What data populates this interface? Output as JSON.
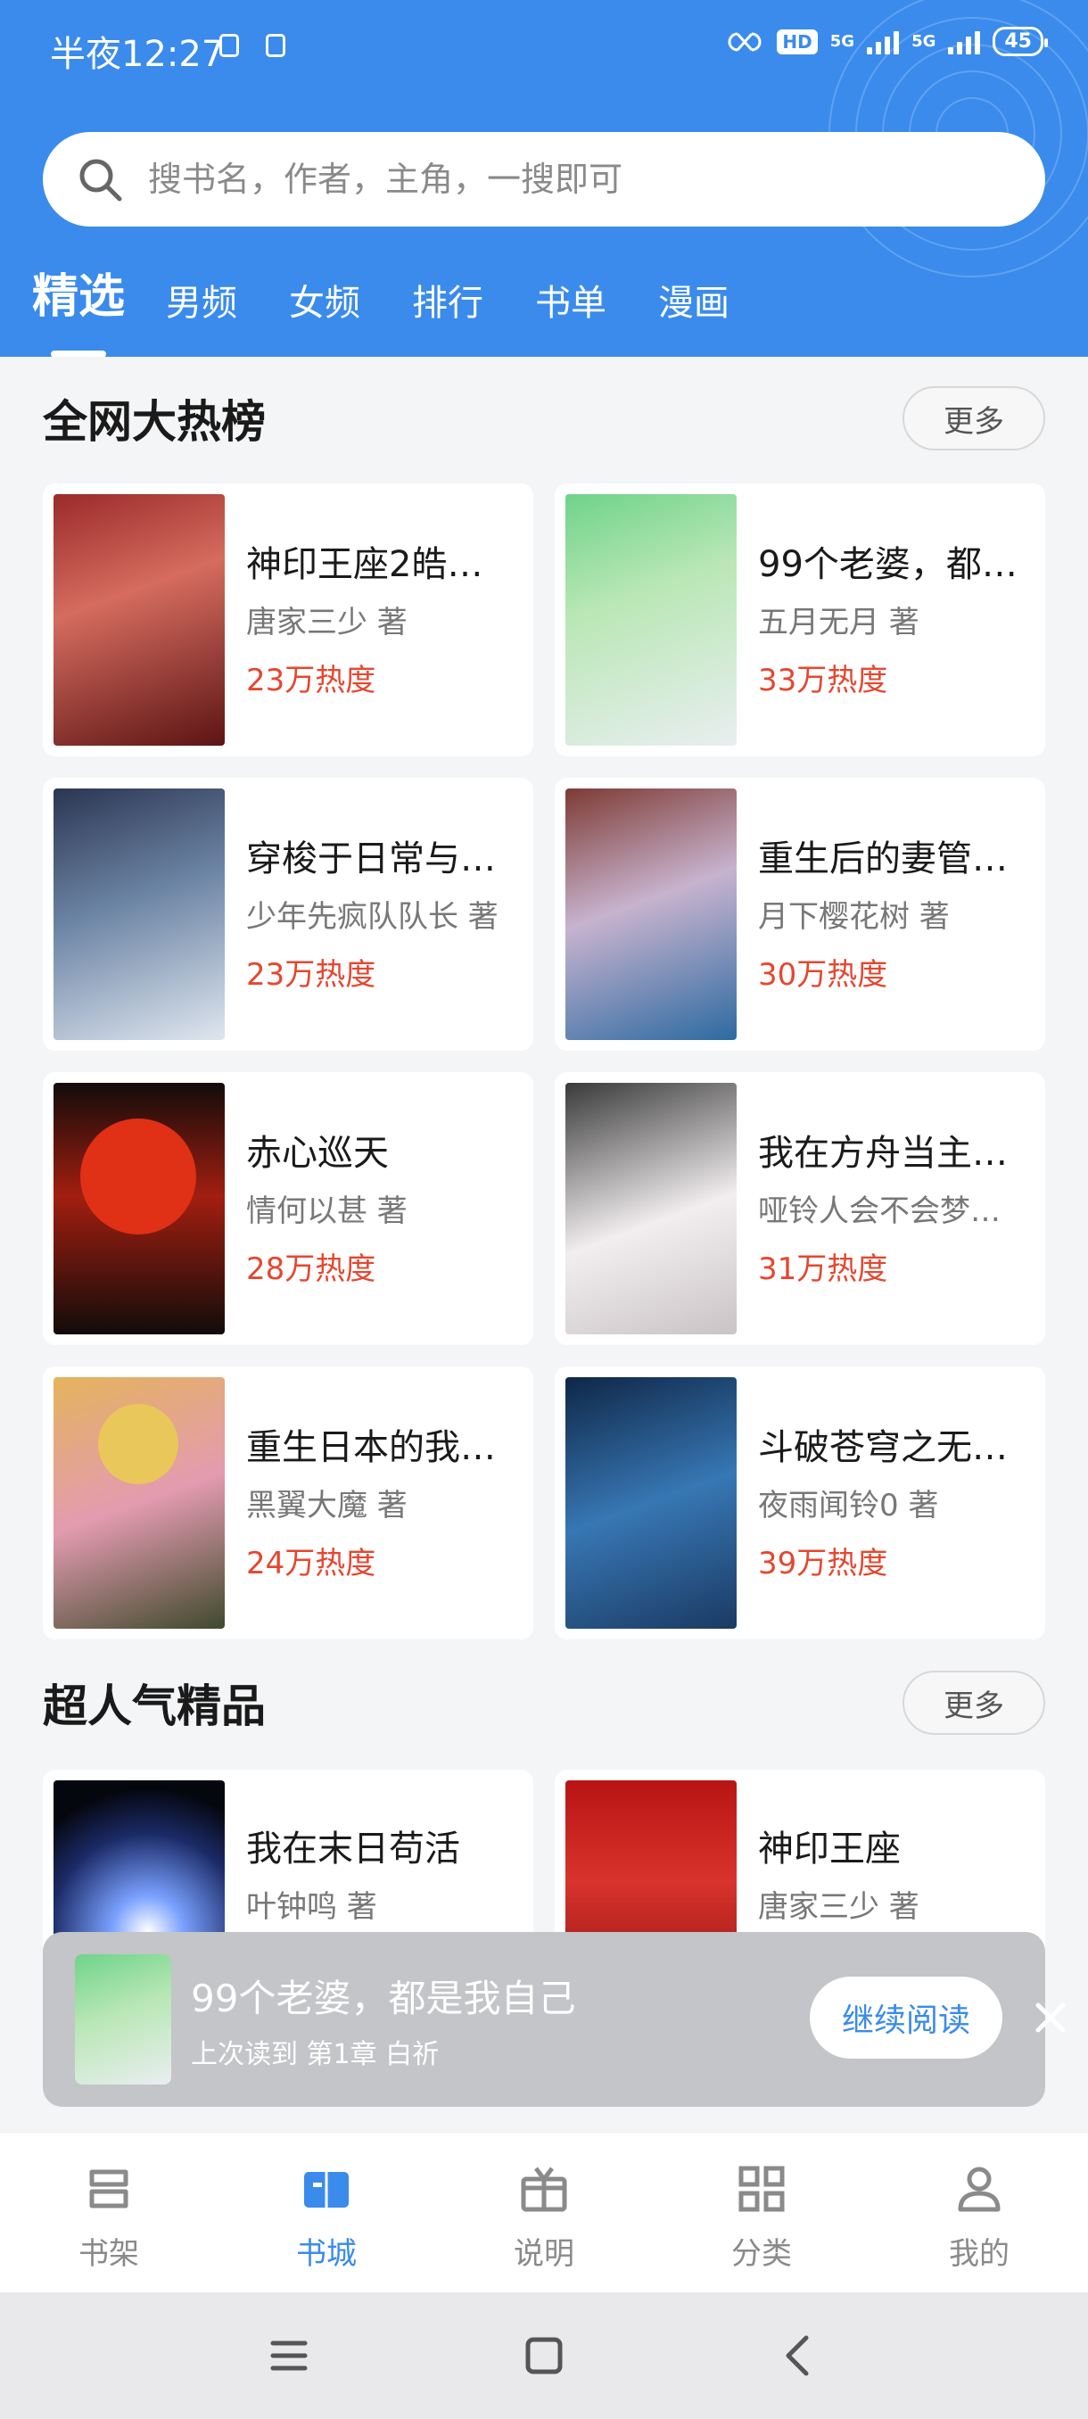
{
  "status_bar": {
    "time": "半夜12:27",
    "hd": "HD",
    "network": "5G",
    "battery": "45"
  },
  "search": {
    "placeholder": "搜书名，作者，主角，一搜即可"
  },
  "tabs": [
    {
      "label": "精选",
      "active": true
    },
    {
      "label": "男频"
    },
    {
      "label": "女频"
    },
    {
      "label": "排行"
    },
    {
      "label": "书单"
    },
    {
      "label": "漫画"
    }
  ],
  "sections": [
    {
      "title": "全网大热榜",
      "more_label": "更多",
      "books": [
        {
          "title": "神印王座2皓…",
          "author": "唐家三少 著",
          "heat": "23万热度"
        },
        {
          "title": "99个老婆，都…",
          "author": "五月无月 著",
          "heat": "33万热度"
        },
        {
          "title": "穿梭于日常与…",
          "author": "少年先疯队队长 著",
          "heat": "23万热度"
        },
        {
          "title": "重生后的妻管…",
          "author": "月下樱花树 著",
          "heat": "30万热度"
        },
        {
          "title": "赤心巡天",
          "author": "情何以甚 著",
          "heat": "28万热度"
        },
        {
          "title": "我在方舟当主…",
          "author": "哑铃人会不会梦…",
          "heat": "31万热度"
        },
        {
          "title": "重生日本的我…",
          "author": "黑翼大魔 著",
          "heat": "24万热度"
        },
        {
          "title": "斗破苍穹之无…",
          "author": "夜雨闻铃0 著",
          "heat": "39万热度"
        }
      ]
    },
    {
      "title": "超人气精品",
      "more_label": "更多",
      "books": [
        {
          "title": "我在末日苟活",
          "author": "叶钟鸣 著",
          "heat": ""
        },
        {
          "title": "神印王座",
          "author": "唐家三少 著",
          "heat": ""
        }
      ]
    }
  ],
  "continue_reading": {
    "title": "99个老婆，都是我自己",
    "subtitle": "上次读到 第1章 白祈",
    "button": "继续阅读"
  },
  "bottom_nav": [
    {
      "label": "书架",
      "icon": "bookshelf-icon"
    },
    {
      "label": "书城",
      "icon": "bookstore-icon",
      "active": true
    },
    {
      "label": "说明",
      "icon": "gift-icon"
    },
    {
      "label": "分类",
      "icon": "grid-icon"
    },
    {
      "label": "我的",
      "icon": "profile-icon"
    }
  ],
  "colors": {
    "accent": "#3a8bec",
    "heat": "#e5472f"
  }
}
